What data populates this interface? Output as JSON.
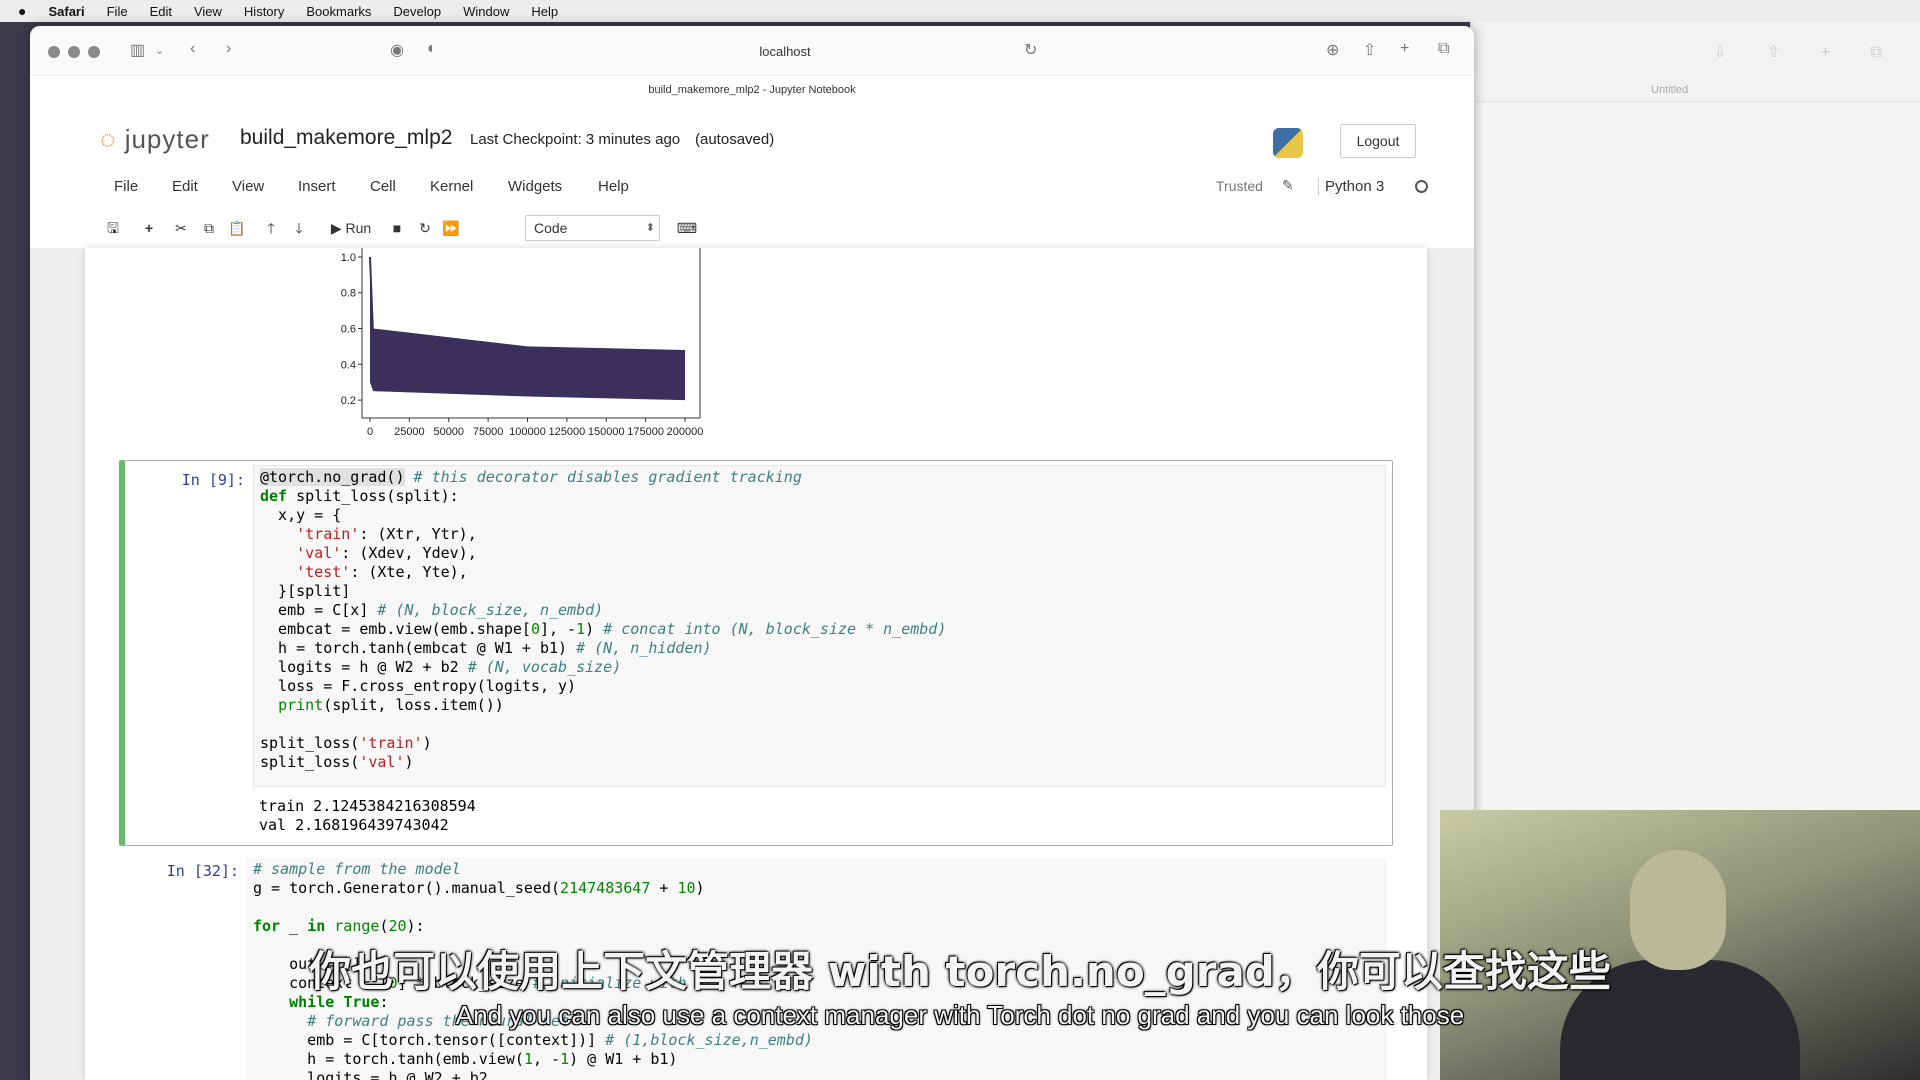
{
  "mac_menu": {
    "apple": "",
    "app": "Safari",
    "items": [
      "File",
      "Edit",
      "View",
      "History",
      "Bookmarks",
      "Develop",
      "Window",
      "Help"
    ]
  },
  "browser": {
    "url": "localhost",
    "tab_title": "build_makemore_mlp2 - Jupyter Notebook",
    "background_tab": "Untitled"
  },
  "jupyter": {
    "logo": "jupyter",
    "notebook_name": "build_makemore_mlp2",
    "checkpoint": "Last Checkpoint: 3 minutes ago",
    "autosaved": "(autosaved)",
    "logout": "Logout",
    "menu": [
      "File",
      "Edit",
      "View",
      "Insert",
      "Cell",
      "Kernel",
      "Widgets",
      "Help"
    ],
    "trusted": "Trusted",
    "kernel": "Python 3",
    "toolbar": {
      "run": "Run",
      "cell_type": "Code"
    }
  },
  "chart_data": {
    "type": "line",
    "x_ticks": [
      "0",
      "25000",
      "50000",
      "75000",
      "100000",
      "125000",
      "150000",
      "175000",
      "200000"
    ],
    "y_ticks": [
      "0.2",
      "0.4",
      "0.6",
      "0.8",
      "1.0"
    ],
    "xlim": [
      0,
      200000
    ],
    "ylim": [
      0.1,
      1.05
    ],
    "series_color": "#3b2f5c",
    "approx_points": [
      {
        "x": 0,
        "y": 1.0
      },
      {
        "x": 2000,
        "y": 0.55
      },
      {
        "x": 10000,
        "y": 0.42
      },
      {
        "x": 50000,
        "y": 0.38
      },
      {
        "x": 100000,
        "y": 0.36
      },
      {
        "x": 150000,
        "y": 0.35
      },
      {
        "x": 200000,
        "y": 0.34
      }
    ],
    "band_low": [
      {
        "x": 2000,
        "y": 0.25
      },
      {
        "x": 100000,
        "y": 0.22
      },
      {
        "x": 200000,
        "y": 0.2
      }
    ],
    "band_high": [
      {
        "x": 2000,
        "y": 0.6
      },
      {
        "x": 100000,
        "y": 0.5
      },
      {
        "x": 200000,
        "y": 0.48
      }
    ]
  },
  "cell9": {
    "prompt": "In [9]:",
    "output": [
      "train 2.1245384216308594",
      "val 2.168196439743042"
    ]
  },
  "cell32": {
    "prompt": "In [32]:"
  },
  "subtitles": {
    "zh": "你也可以使用上下文管理器 with torch.no_grad，你可以查找这些",
    "en": "And you can also use a context manager with Torch dot no grad and you can look those"
  }
}
